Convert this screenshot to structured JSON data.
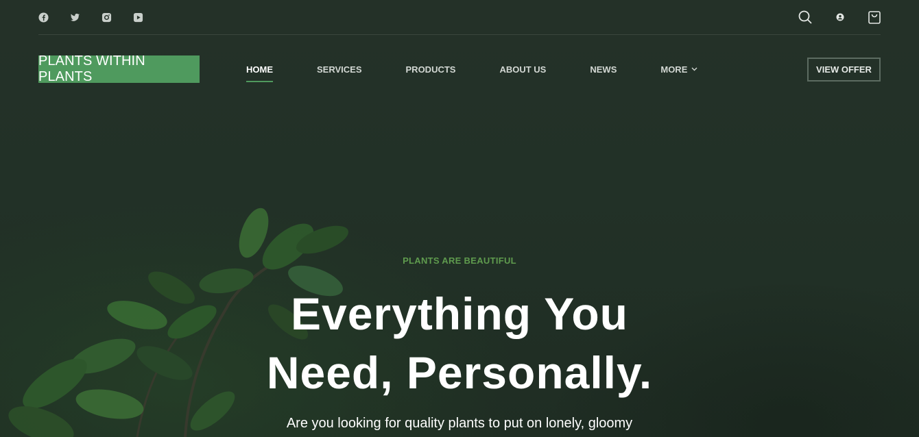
{
  "social": {
    "icons": [
      "facebook-icon",
      "twitter-icon",
      "instagram-icon",
      "youtube-icon"
    ]
  },
  "utilities": {
    "icons": [
      "search-icon",
      "user-icon",
      "shopping-bag-icon"
    ]
  },
  "brand": {
    "logo_text": "PLANTS WITHIN PLANTS",
    "logo_color": "#4f9a5e"
  },
  "nav": {
    "items": [
      {
        "label": "HOME",
        "active": true
      },
      {
        "label": "SERVICES"
      },
      {
        "label": "PRODUCTS"
      },
      {
        "label": "ABOUT US"
      },
      {
        "label": "NEWS"
      },
      {
        "label": "MORE",
        "has_dropdown": true
      }
    ],
    "cta_label": "VIEW OFFER"
  },
  "hero": {
    "eyebrow": "PLANTS ARE BEAUTIFUL",
    "headline_line1": "Everything You",
    "headline_line2": "Need, Personally.",
    "subtext": "Are you looking for quality plants to put on lonely, gloomy"
  },
  "colors": {
    "background": "#223127",
    "accent": "#4f9a5e",
    "eyebrow": "#5f9b4e"
  }
}
